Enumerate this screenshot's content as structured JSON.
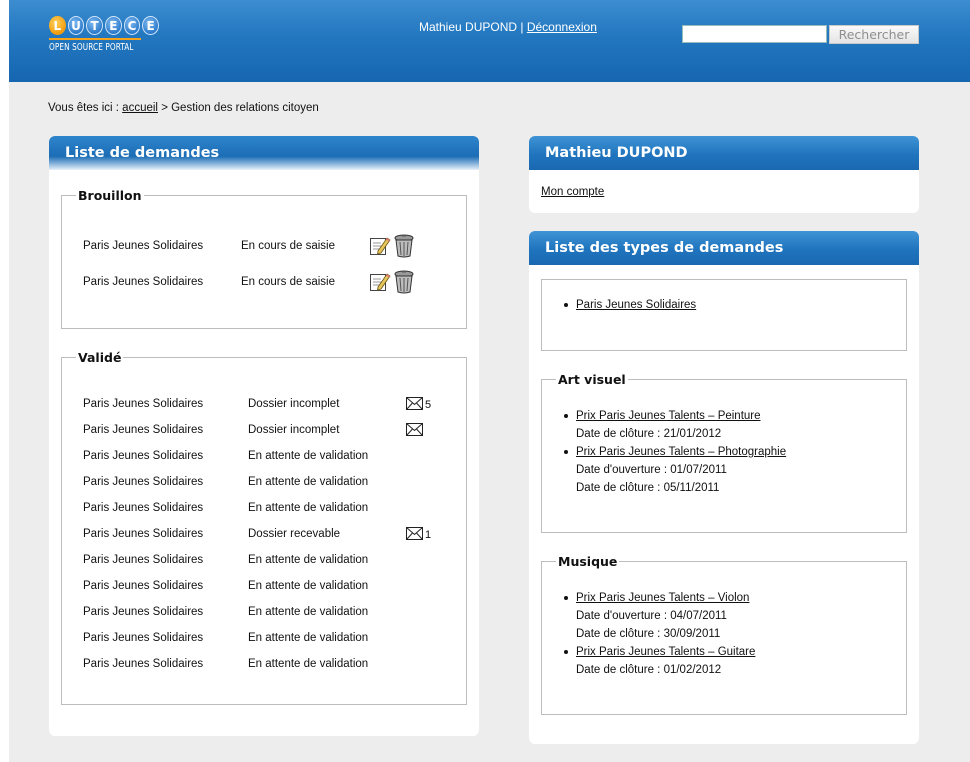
{
  "header": {
    "logo_letters": [
      "L",
      "U",
      "T",
      "E",
      "C",
      "E"
    ],
    "logo_subtitle": "OPEN SOURCE PORTAL",
    "user_name": "Mathieu DUPOND",
    "separator": "|",
    "logout_label": "Déconnexion",
    "search_placeholder": "",
    "search_button_label": "Rechercher"
  },
  "breadcrumb": {
    "prefix": "Vous êtes ici :",
    "home_label": "accueil",
    "separator": ">",
    "current": "Gestion des relations citoyen"
  },
  "demandes_panel": {
    "title": "Liste de demandes",
    "brouillon": {
      "legend": "Brouillon",
      "rows": [
        {
          "name": "Paris Jeunes Solidaires",
          "status": "En cours de saisie"
        },
        {
          "name": "Paris Jeunes Solidaires",
          "status": "En cours de saisie"
        }
      ]
    },
    "valide": {
      "legend": "Validé",
      "rows": [
        {
          "name": "Paris Jeunes Solidaires",
          "status": "Dossier incomplet",
          "messages": "5",
          "has_mail": true
        },
        {
          "name": "Paris Jeunes Solidaires",
          "status": "Dossier incomplet",
          "messages": "",
          "has_mail": true
        },
        {
          "name": "Paris Jeunes Solidaires",
          "status": "En attente de validation",
          "messages": "",
          "has_mail": false
        },
        {
          "name": "Paris Jeunes Solidaires",
          "status": "En attente de validation",
          "messages": "",
          "has_mail": false
        },
        {
          "name": "Paris Jeunes Solidaires",
          "status": "En attente de validation",
          "messages": "",
          "has_mail": false
        },
        {
          "name": "Paris Jeunes Solidaires",
          "status": "Dossier recevable",
          "messages": "1",
          "has_mail": true
        },
        {
          "name": "Paris Jeunes Solidaires",
          "status": "En attente de validation",
          "messages": "",
          "has_mail": false
        },
        {
          "name": "Paris Jeunes Solidaires",
          "status": "En attente de validation",
          "messages": "",
          "has_mail": false
        },
        {
          "name": "Paris Jeunes Solidaires",
          "status": "En attente de validation",
          "messages": "",
          "has_mail": false
        },
        {
          "name": "Paris Jeunes Solidaires",
          "status": "En attente de validation",
          "messages": "",
          "has_mail": false
        },
        {
          "name": "Paris Jeunes Solidaires",
          "status": "En attente de validation",
          "messages": "",
          "has_mail": false
        }
      ]
    }
  },
  "user_panel": {
    "title": "Mathieu DUPOND",
    "account_link": "Mon compte"
  },
  "types_panel": {
    "title": "Liste des types de demandes",
    "general": {
      "items": [
        {
          "label": "Paris Jeunes Solidaires",
          "details": []
        }
      ]
    },
    "art_visuel": {
      "legend": "Art visuel",
      "items": [
        {
          "label": "Prix Paris Jeunes Talents – Peinture",
          "details": [
            "Date de clôture : 21/01/2012"
          ]
        },
        {
          "label": "Prix Paris Jeunes Talents – Photographie",
          "details": [
            "Date d'ouverture : 01/07/2011",
            "Date de clôture : 05/11/2011"
          ]
        }
      ]
    },
    "musique": {
      "legend": "Musique",
      "items": [
        {
          "label": "Prix Paris Jeunes Talents – Violon",
          "details": [
            "Date d'ouverture : 04/07/2011",
            "Date de clôture : 30/09/2011"
          ]
        },
        {
          "label": "Prix Paris Jeunes Talents – Guitare",
          "details": [
            "Date de clôture : 01/02/2012"
          ]
        }
      ]
    }
  },
  "colors": {
    "header_blue": "#1f74bd",
    "logo_orange": "#f29b0d",
    "page_gray": "#ededed"
  }
}
